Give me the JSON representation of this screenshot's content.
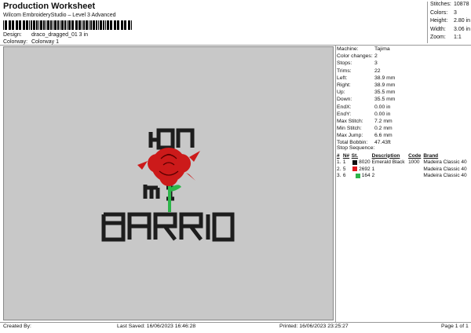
{
  "header": {
    "title": "Production Worksheet",
    "subtitle": "Wilcom EmbroideryStudio – Level 3 Advanced",
    "design_label": "Design:",
    "design_value": "draco_dragged_01 3 in",
    "colorway_label": "Colorway:",
    "colorway_value": "Colorway 1"
  },
  "top_stats": [
    {
      "label": "Stitches:",
      "value": "10878"
    },
    {
      "label": "Colors:",
      "value": "3"
    },
    {
      "label": "Height:",
      "value": "2.80 in"
    },
    {
      "label": "Width:",
      "value": "3.06 in"
    },
    {
      "label": "Zoom:",
      "value": "1:1"
    }
  ],
  "design": {
    "top_text": "ЮЛ",
    "mid_text": "MI",
    "bottom_text": "BARRIO",
    "letter_color": "#1d1d1d",
    "rose_color": "#cc1a1a",
    "stem_color": "#2db54a"
  },
  "specs": [
    {
      "label": "Machine:",
      "value": "Tajima"
    },
    {
      "label": "Color changes:",
      "value": "2"
    },
    {
      "label": "Stops:",
      "value": "3"
    },
    {
      "label": "Trims:",
      "value": "22"
    },
    {
      "label": "Left:",
      "value": "38.9 mm"
    },
    {
      "label": "Right:",
      "value": "38.9 mm"
    },
    {
      "label": "Up:",
      "value": "35.5 mm"
    },
    {
      "label": "Down:",
      "value": "35.5 mm"
    },
    {
      "label": "EndX:",
      "value": "0.00 in"
    },
    {
      "label": "EndY:",
      "value": "0.00 in"
    },
    {
      "label": "Max Stitch:",
      "value": "7.2 mm"
    },
    {
      "label": "Min Stitch:",
      "value": "0.2 mm"
    },
    {
      "label": "Max Jump:",
      "value": "6.6 mm"
    },
    {
      "label": "Total Bobbin:",
      "value": "47.43ft"
    }
  ],
  "stop_sequence": {
    "title": "Stop Sequence:",
    "headers": [
      "#",
      "N#",
      "St.",
      "Description",
      "Code",
      "Brand"
    ],
    "rows": [
      {
        "num": "1.",
        "n": "1",
        "color": "#111111",
        "st": "8020",
        "desc": "Emerald Black",
        "code": "1000",
        "brand": "Madeira Classic 40"
      },
      {
        "num": "2.",
        "n": "5",
        "color": "#e0191f",
        "st": "2692",
        "desc": "1",
        "code": "",
        "brand": "Madeira Classic 40"
      },
      {
        "num": "3.",
        "n": "6",
        "color": "#2db54a",
        "st": "164",
        "desc": "2",
        "code": "",
        "brand": "Madeira Classic 40"
      }
    ]
  },
  "footer": {
    "created_by": "Created By:",
    "last_saved": "Last Saved: 16/06/2023 16:46:28",
    "printed": "Printed: 16/06/2023 23:25:27",
    "page": "Page 1 of 1"
  }
}
